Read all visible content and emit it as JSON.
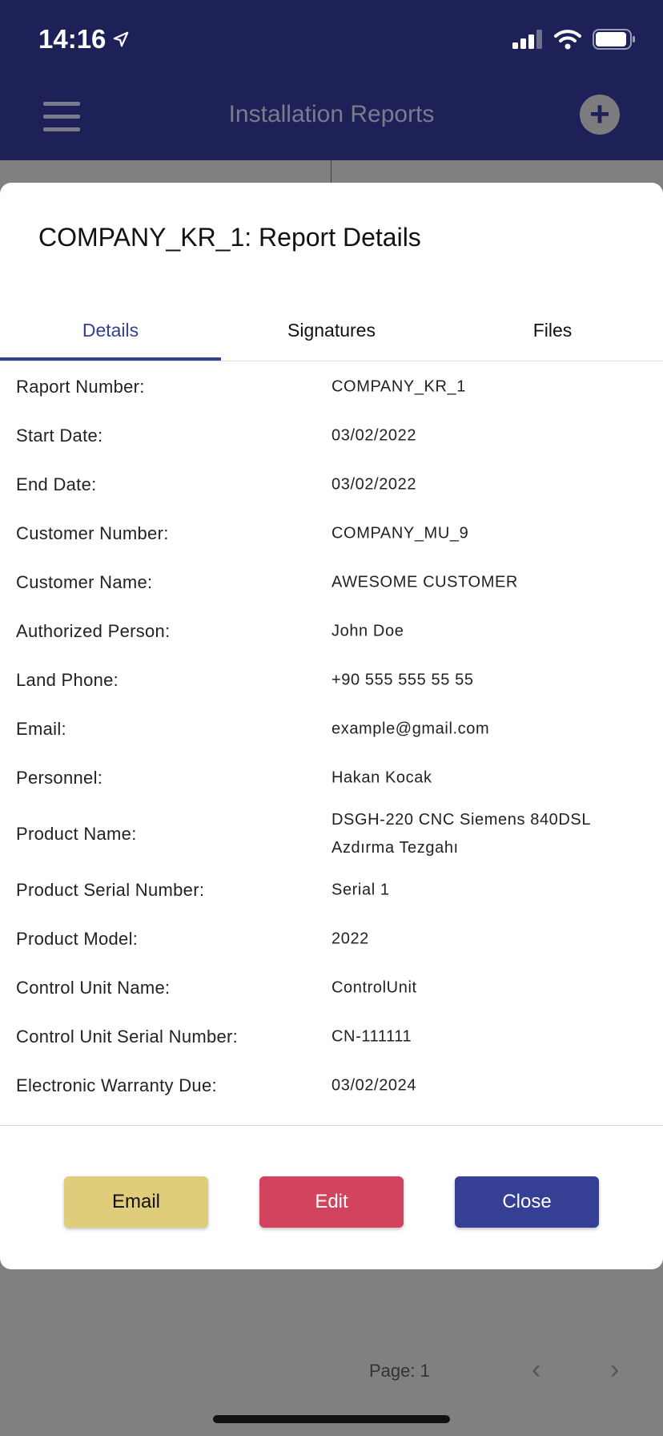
{
  "status_bar": {
    "time": "14:16",
    "location_icon": "location-arrow-icon",
    "signal_icon": "cellular-signal-icon",
    "wifi_icon": "wifi-icon",
    "battery_icon": "battery-icon"
  },
  "app_bar": {
    "title": "Installation Reports",
    "menu_icon": "hamburger-menu-icon",
    "add_icon": "plus-circle-icon"
  },
  "modal": {
    "title": "COMPANY_KR_1: Report Details",
    "tabs": [
      {
        "label": "Details",
        "active": true
      },
      {
        "label": "Signatures",
        "active": false
      },
      {
        "label": "Files",
        "active": false
      }
    ],
    "details": [
      {
        "label": "Raport Number:",
        "value": "COMPANY_KR_1"
      },
      {
        "label": "Start Date:",
        "value": "03/02/2022"
      },
      {
        "label": "End Date:",
        "value": "03/02/2022"
      },
      {
        "label": "Customer Number:",
        "value": "COMPANY_MU_9"
      },
      {
        "label": "Customer Name:",
        "value": "AWESOME CUSTOMER"
      },
      {
        "label": "Authorized Person:",
        "value": "John Doe"
      },
      {
        "label": "Land Phone:",
        "value": "+90 555 555 55 55"
      },
      {
        "label": "Email:",
        "value": "example@gmail.com"
      },
      {
        "label": "Personnel:",
        "value": "Hakan Kocak"
      },
      {
        "label": "Product Name:",
        "value": "DSGH-220 CNC Siemens 840DSL Azdırma Tezgahı"
      },
      {
        "label": "Product Serial Number:",
        "value": "Serial 1"
      },
      {
        "label": "Product Model:",
        "value": "2022"
      },
      {
        "label": "Control Unit Name:",
        "value": "ControlUnit"
      },
      {
        "label": "Control Unit Serial Number:",
        "value": "CN-111111"
      },
      {
        "label": "Electronic Warranty Due:",
        "value": "03/02/2024"
      }
    ],
    "buttons": {
      "email": "Email",
      "edit": "Edit",
      "close": "Close"
    }
  },
  "pagination": {
    "page_text": "Page: 1",
    "prev_icon": "chevron-left-icon",
    "next_icon": "chevron-right-icon"
  },
  "colors": {
    "header_bg": "#1e2157",
    "accent": "#353f94",
    "email_button": "#dfcd7c",
    "edit_button": "#d2435d",
    "close_button": "#353f94",
    "overlay": "#808080"
  }
}
